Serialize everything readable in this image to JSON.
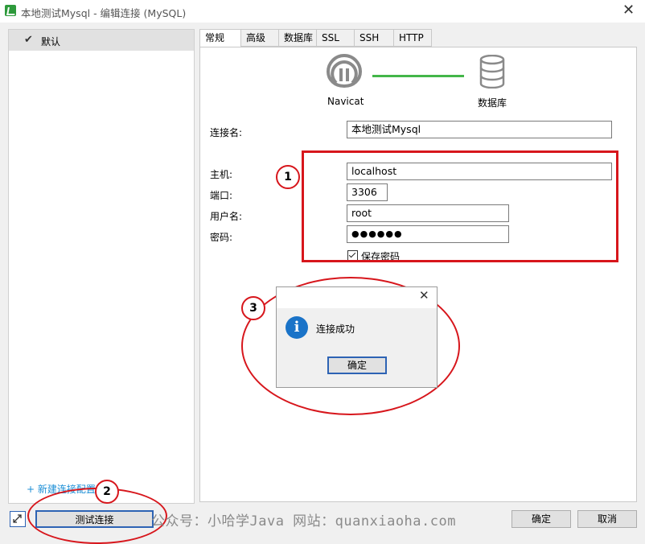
{
  "window": {
    "title": "本地测试Mysql - 编辑连接 (MySQL)",
    "close_icon": "close-icon"
  },
  "left_panel": {
    "items": [
      {
        "label": "默认"
      }
    ],
    "new_link": "+ 新建连接配置表"
  },
  "tabs": [
    {
      "label": "常规"
    },
    {
      "label": "高级"
    },
    {
      "label": "数据库"
    },
    {
      "label": "SSL"
    },
    {
      "label": "SSH"
    },
    {
      "label": "HTTP"
    }
  ],
  "connection_graphic": {
    "left_label": "Navicat",
    "right_label": "数据库"
  },
  "form": {
    "connection_name": {
      "label": "连接名:",
      "value": "本地测试Mysql"
    },
    "host": {
      "label": "主机:",
      "value": "localhost"
    },
    "port": {
      "label": "端口:",
      "value": "3306"
    },
    "username": {
      "label": "用户名:",
      "value": "root"
    },
    "password": {
      "label": "密码:",
      "value": "●●●●●●"
    },
    "save_password": {
      "label": "保存密码",
      "checked": true
    }
  },
  "annotations": {
    "badge1": "1",
    "badge2": "2",
    "badge3": "3",
    "color": "#d7161c"
  },
  "dialog": {
    "message": "连接成功",
    "ok_label": "确定"
  },
  "bottom": {
    "test_button": "测试连接",
    "ok_button": "确定",
    "cancel_button": "取消",
    "watermark": "公众号：小哈学Java 网站：quanxiaoha.com"
  }
}
